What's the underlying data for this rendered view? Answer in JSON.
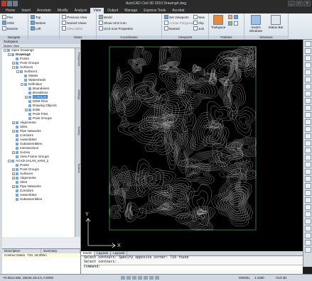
{
  "window": {
    "title": "AutoCAD Civil 3D 2010   Drawing4.dwg"
  },
  "ribbon_tabs": [
    "Home",
    "Insert",
    "Annotate",
    "Modify",
    "Analyze",
    "View",
    "Output",
    "Manage",
    "Express Tools",
    "Acrobat"
  ],
  "active_tab": "View",
  "ribbon": {
    "navigate": {
      "title": "Navigate",
      "items": [
        "Pan",
        "Orbit",
        "Extents"
      ]
    },
    "views_a": {
      "items": [
        "Top",
        "Bottom",
        "Left"
      ]
    },
    "views_b": {
      "title": "Views",
      "items": [
        "Previous View",
        "Named Views",
        "View Editor"
      ]
    },
    "coordinates": {
      "title": "Coordinates",
      "items": [
        "World",
        "Show UCS Icon",
        "UCS Icon Properties"
      ]
    },
    "viewports": {
      "title": "Viewports",
      "items": [
        "Set Viewports",
        "Create Polygonal",
        "Named",
        "New",
        "Clip",
        "Join"
      ]
    },
    "palettes": {
      "title": "Palettes",
      "toolspace": "Toolspace"
    },
    "windows": {
      "title": "Windows",
      "switch": "Switch Windows",
      "status": "Status Bar"
    }
  },
  "toolspace": {
    "title": "Toolspace",
    "view_label": "Master View",
    "tree": [
      {
        "label": "Open Drawings",
        "level": 0,
        "tw": "-"
      },
      {
        "label": "Drawing4",
        "level": 1,
        "tw": "-",
        "bold": true
      },
      {
        "label": "Points",
        "level": 2,
        "tw": ""
      },
      {
        "label": "Point Groups",
        "level": 2,
        "tw": "+"
      },
      {
        "label": "Surfaces",
        "level": 2,
        "tw": "-"
      },
      {
        "label": "Surface1",
        "level": 3,
        "tw": "-"
      },
      {
        "label": "Masks",
        "level": 4,
        "tw": ""
      },
      {
        "label": "Watersheds",
        "level": 4,
        "tw": ""
      },
      {
        "label": "Definition",
        "level": 4,
        "tw": "-"
      },
      {
        "label": "Boundaries",
        "level": 5,
        "tw": ""
      },
      {
        "label": "Breaklines",
        "level": 5,
        "tw": ""
      },
      {
        "label": "Contours",
        "level": 5,
        "tw": "+",
        "sel": true
      },
      {
        "label": "DEM Files",
        "level": 5,
        "tw": ""
      },
      {
        "label": "Drawing Objects",
        "level": 5,
        "tw": ""
      },
      {
        "label": "Edits",
        "level": 5,
        "tw": "+"
      },
      {
        "label": "Point Files",
        "level": 5,
        "tw": ""
      },
      {
        "label": "Point Groups",
        "level": 5,
        "tw": ""
      },
      {
        "label": "Alignments",
        "level": 2,
        "tw": "+"
      },
      {
        "label": "Sites",
        "level": 2,
        "tw": ""
      },
      {
        "label": "Pipe Networks",
        "level": 2,
        "tw": "+"
      },
      {
        "label": "Corridors",
        "level": 2,
        "tw": ""
      },
      {
        "label": "Assemblies",
        "level": 2,
        "tw": ""
      },
      {
        "label": "Subassemblies",
        "level": 2,
        "tw": ""
      },
      {
        "label": "Intersections",
        "level": 2,
        "tw": ""
      },
      {
        "label": "Survey",
        "level": 2,
        "tw": "+"
      },
      {
        "label": "View Frame Groups",
        "level": 2,
        "tw": ""
      },
      {
        "label": "ACAD-JALAN_KKM_2",
        "level": 1,
        "tw": "-"
      },
      {
        "label": "Points",
        "level": 2,
        "tw": ""
      },
      {
        "label": "Point Groups",
        "level": 2,
        "tw": "+"
      },
      {
        "label": "Surfaces",
        "level": 2,
        "tw": "+"
      },
      {
        "label": "Alignments",
        "level": 2,
        "tw": "+"
      },
      {
        "label": "Sites",
        "level": 2,
        "tw": ""
      },
      {
        "label": "Pipe Networks",
        "level": 2,
        "tw": "+"
      },
      {
        "label": "Corridors",
        "level": 2,
        "tw": ""
      },
      {
        "label": "Assemblies",
        "level": 2,
        "tw": ""
      },
      {
        "label": "Subassemblies",
        "level": 2,
        "tw": ""
      }
    ],
    "vertical_tabs": [
      "Prospector",
      "Settings",
      "Survey",
      "Toolbox"
    ],
    "desc_header": [
      "Description",
      "Summary"
    ],
    "desc_row": [
      "Contour Data1",
      "710, 18,000m"
    ]
  },
  "layout_tabs": [
    "Model",
    "Layout1",
    "Layout2"
  ],
  "command_lines": [
    "Select contours: Specify opposite corner: 710 found",
    "Select contours:"
  ],
  "command_prompt": "Command:",
  "status": {
    "coords": "-70.0514.682, 3922K.20.0.0, 0.0000",
    "model": "MODEL",
    "scale": "1:1000",
    "workspace": "Civil 3D"
  },
  "colors": {
    "contour": "#d8d8d8",
    "sheet_border": "#2fa04a",
    "ucs": "#e8e8e8"
  }
}
